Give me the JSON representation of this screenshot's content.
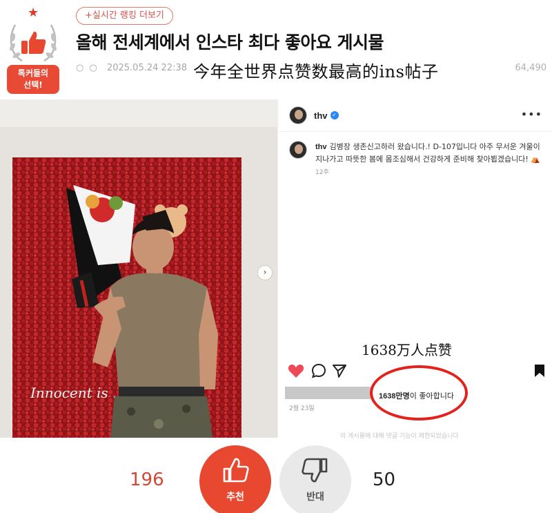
{
  "badge": {
    "label_line1": "톡커들의",
    "label_line2": "선택!",
    "icon": "thumbs-up-wreath-icon"
  },
  "header": {
    "ranking_link": "+실시간 랭킹 더보기",
    "title": "올해 전세계에서 인스타 최다 좋아요 게시물",
    "meta_dots": "○ ○",
    "timestamp": "2025.05.24 22:38",
    "views": "64,490",
    "overlay_caption": "今年全世界点赞数最高的ins帖子"
  },
  "instagram": {
    "username": "thv",
    "comment_username": "thv",
    "comment_text": "김병장 생존신고하러 왔습니다.! D-107입니다 아주 무서운 겨울이 지나가고 따뜻한 봄에 몸조심해서 건강하게 준비해 찾아뵙겠습니다! ⛺",
    "comment_age": "12주",
    "likes_bold": "1638만명",
    "likes_rest": "이 좋아합니다",
    "post_date": "2월 23일",
    "footer_note": "이 게시물에 대해 댓글 기능이 제한되었습니다",
    "photo_wall_text": "Innocent is ... city",
    "overlay_likes_caption": "1638万人点赞",
    "highlight_color": "#e3211d"
  },
  "votes": {
    "up_count": "196",
    "up_label": "추천",
    "down_count": "50",
    "down_label": "반대",
    "up_color": "#e8482f",
    "down_color": "#e9e9e9"
  }
}
